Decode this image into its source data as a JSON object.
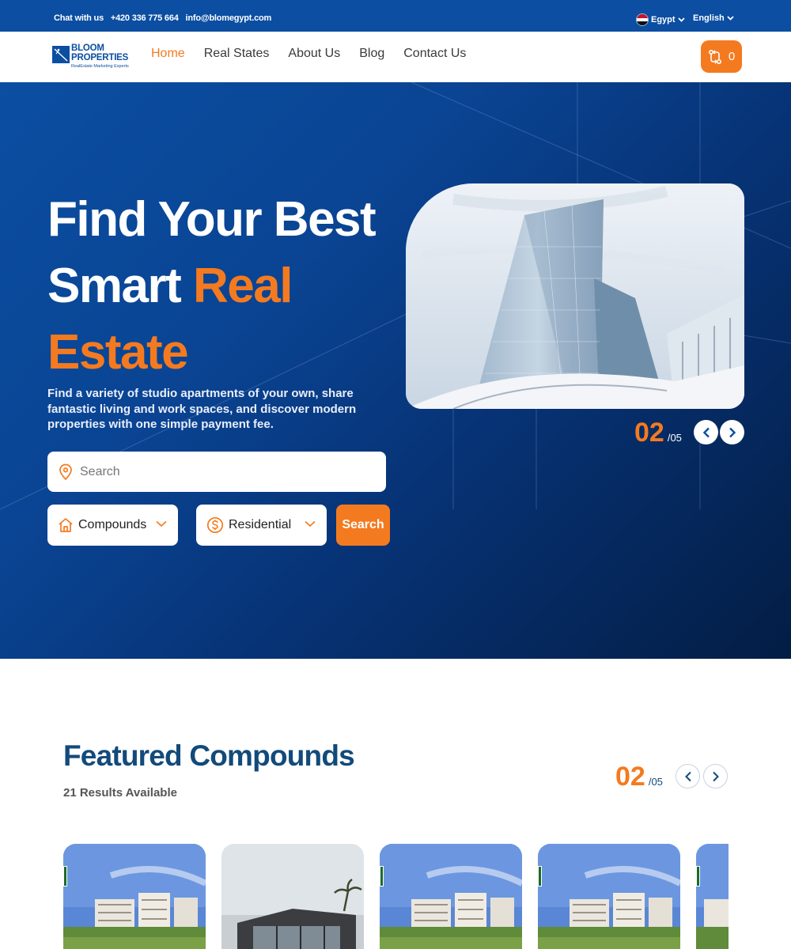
{
  "topbar": {
    "chat_label": "Chat with us",
    "phone": "+420 336 775 664",
    "email": "info@blomegypt.com",
    "country": "Egypt",
    "language": "English"
  },
  "nav": {
    "logo_line1": "BLOOM",
    "logo_line2": "PROPERTIES",
    "logo_tagline": "RealEstate Marketing Experts",
    "items": [
      {
        "label": "Home",
        "active": true
      },
      {
        "label": "Real States"
      },
      {
        "label": "About Us"
      },
      {
        "label": "Blog"
      },
      {
        "label": "Contact Us"
      }
    ],
    "compare_count": "0"
  },
  "hero": {
    "title_line1": "Find Your Best",
    "title_line2_plain": "Smart ",
    "title_line2_accent": "Real",
    "title_line3_accent": "Estate",
    "description": "Find a variety of studio apartments of your own, share fantastic living and work spaces, and discover modern properties with one simple payment fee.",
    "search_placeholder": "Search",
    "type_select": "Compounds",
    "category_select": "Residential",
    "search_button": "Search",
    "slide_current": "02",
    "slide_total": "/05"
  },
  "featured": {
    "title": "Featured Compounds",
    "results": "21 Results Available",
    "slide_current": "02",
    "slide_total": "/05"
  },
  "colors": {
    "brand_blue": "#0b4ea2",
    "accent_orange": "#f47a20",
    "heading_navy": "#124a7a"
  }
}
